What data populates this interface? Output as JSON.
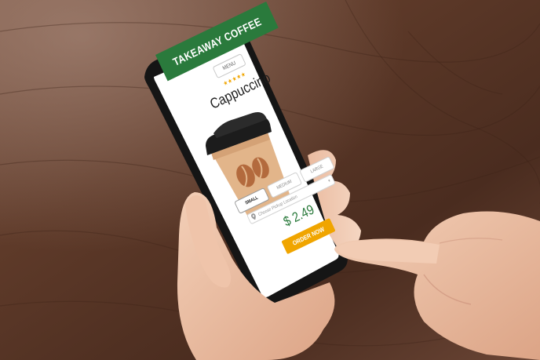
{
  "app": {
    "header_title": "TAKEAWAY COFFEE",
    "menu_label": "MENU",
    "rating_stars": "★★★★★",
    "rating_value": 5,
    "product_name": "Cappuccino",
    "sizes": [
      "SMALL",
      "MEDIUM",
      "LARGE"
    ],
    "selected_size": "SMALL",
    "pickup_placeholder": "Choose Pickup Location",
    "price": "$ 2.49",
    "order_button": "ORDER NOW"
  },
  "colors": {
    "brand_green": "#2a7a3c",
    "accent_orange": "#f0a500",
    "cup_kraft": "#e2b58a",
    "lid_black": "#1c1c1c",
    "table_wood": "#5a3828"
  },
  "icons": [
    "location-pin-icon",
    "coffee-beans-icon",
    "chevron-down-icon"
  ]
}
